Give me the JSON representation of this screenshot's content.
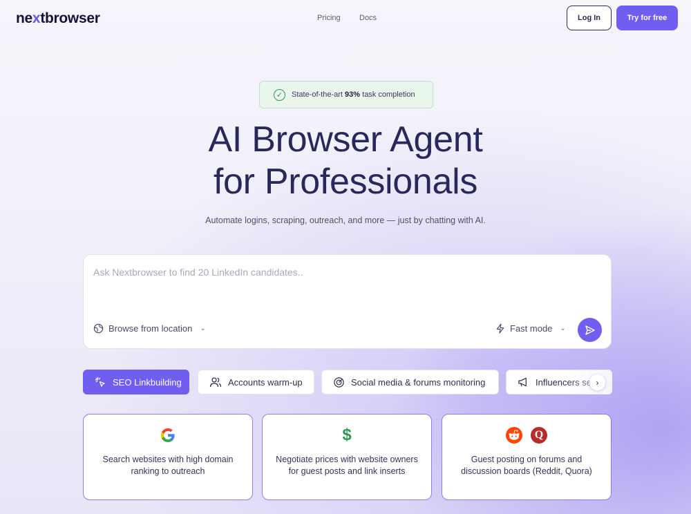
{
  "header": {
    "logo_pre": "ne",
    "logo_x": "x",
    "logo_post": "tbrowser",
    "nav": [
      "Pricing",
      "Docs"
    ],
    "login_label": "Log In",
    "try_label": "Try for free"
  },
  "hero": {
    "badge_pre": "State-of-the-art ",
    "badge_bold": "93%",
    "badge_post": " task completion",
    "title_line1": "AI Browser Agent",
    "title_line2": "for Professionals",
    "subtitle": "Automate logins, scraping, outreach, and more — just by chatting with AI."
  },
  "input": {
    "placeholder": "Ask Nextbrowser to find 20 LinkedIn candidates..",
    "location_label": "Browse from location",
    "mode_label": "Fast mode"
  },
  "tabs": [
    {
      "label": "SEO Linkbuilding",
      "active": true
    },
    {
      "label": "Accounts warm-up",
      "active": false
    },
    {
      "label": "Social media & forums monitoring",
      "active": false
    },
    {
      "label": "Influencers se",
      "active": false
    }
  ],
  "cards": [
    {
      "icon": "google-icon",
      "text": "Search websites with high domain ranking to outreach"
    },
    {
      "icon": "dollar-icon",
      "text": "Negotiate prices with website owners for guest posts and link inserts"
    },
    {
      "icon": "reddit-quora-icons",
      "text": "Guest posting on forums and discussion boards (Reddit, Quora)"
    }
  ],
  "colors": {
    "accent": "#6f5ef0",
    "title": "#28285a",
    "success": "#2f9a52"
  }
}
